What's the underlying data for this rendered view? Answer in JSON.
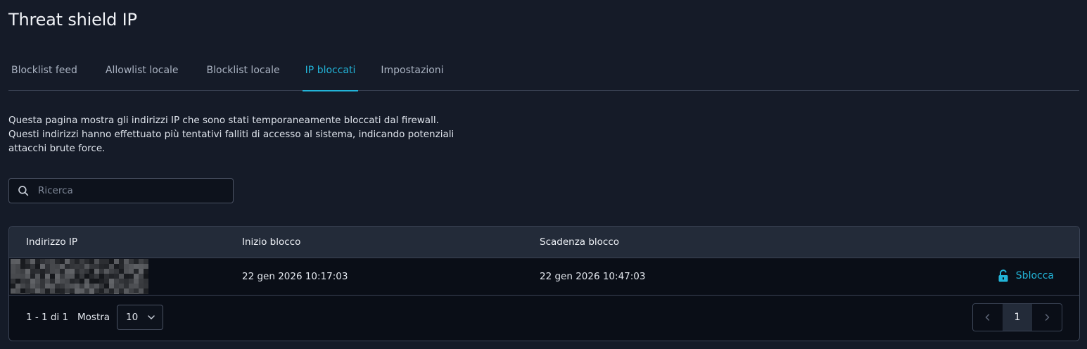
{
  "page": {
    "title": "Threat shield IP"
  },
  "tabs": [
    {
      "label": "Blocklist feed",
      "active": false
    },
    {
      "label": "Allowlist locale",
      "active": false
    },
    {
      "label": "Blocklist locale",
      "active": false
    },
    {
      "label": "IP bloccati",
      "active": true
    },
    {
      "label": "Impostazioni",
      "active": false
    }
  ],
  "description": {
    "line1": "Questa pagina mostra gli indirizzi IP che sono stati temporaneamente bloccati dal firewall.",
    "line2": "Questi indirizzi hanno effettuato più tentativi falliti di accesso al sistema, indicando potenziali",
    "line3": "attacchi brute force."
  },
  "search": {
    "placeholder": "Ricerca",
    "value": "",
    "icon": "search-icon"
  },
  "table": {
    "columns": [
      "Indirizzo IP",
      "Inizio blocco",
      "Scadenza blocco"
    ],
    "rows": [
      {
        "ip": "",
        "ip_redacted": true,
        "start": "22 gen 2026 10:17:03",
        "expiry": "22 gen 2026 10:47:03",
        "action_label": "Sblocca",
        "action_icon": "unlock-icon"
      }
    ]
  },
  "footer": {
    "range": "1 - 1 di 1",
    "show_label": "Mostra",
    "page_size": "10",
    "current_page": "1"
  },
  "colors": {
    "background": "#151b28",
    "accent": "#22b4d8",
    "header_bg": "#232b39",
    "border": "#3a4354"
  }
}
